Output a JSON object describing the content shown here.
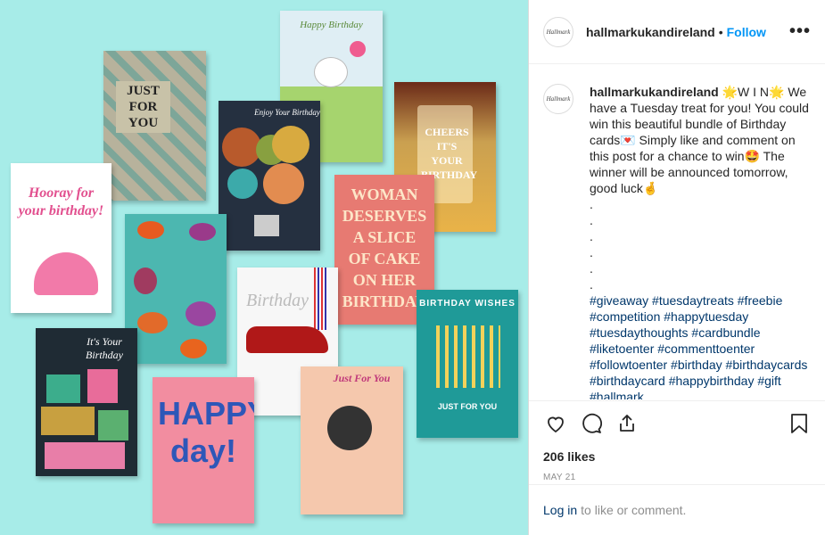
{
  "header": {
    "avatar_text": "Hallmark",
    "username": "hallmarkukandireland",
    "separator": "•",
    "follow_label": "Follow",
    "more_label": "•••"
  },
  "caption": {
    "username": "hallmarkukandireland",
    "lines": [
      "🌟W I N🌟",
      "We have a Tuesday treat for you! You could win this beautiful bundle of Birthday cards💌 Simply like and comment on this post for a chance to win🤩 The winner will be announced tomorrow, good luck🤞"
    ],
    "dots": [
      ".",
      ".",
      ".",
      ".",
      ".",
      "."
    ],
    "hashtags": "#giveaway #tuesdaytreats #freebie #competition #happytuesday #tuesdaythoughts #cardbundle #liketoenter #commenttoenter #followtoenter #birthday #birthdaycards #birthdaycard #happybirthday #gift #hallmark"
  },
  "actions": {
    "icons": [
      "heart-icon",
      "comment-icon",
      "share-icon",
      "bookmark-icon"
    ],
    "likes": "206 likes",
    "date": "MAY 21"
  },
  "login": {
    "link": "Log in",
    "text": "to like or comment."
  },
  "photo": {
    "cards": {
      "just_for_you": "JUST FOR YOU",
      "happy_birthday_bear": "Happy Birthday",
      "enjoy_your_birthday": "Enjoy Your Birthday",
      "cheers": "CHEERS IT'S YOUR BIRTHDAY",
      "hooray": "Hooray for your birthday!",
      "woman": "WOMAN DESERVES A SLICE OF CAKE ON HER BIRTHDAY",
      "birthday_wishes": "BIRTHDAY WISHES",
      "just_for_you_footer": "JUST FOR YOU",
      "its_your_birthday": "It's Your Birthday",
      "happy_day": "HAPPY day!",
      "just_for_you_cat": "Just For You",
      "birthday_car": "Birthday"
    },
    "colors": {
      "background": "#a7ece8",
      "link": "#0095f6",
      "hashtag": "#00376b"
    }
  }
}
